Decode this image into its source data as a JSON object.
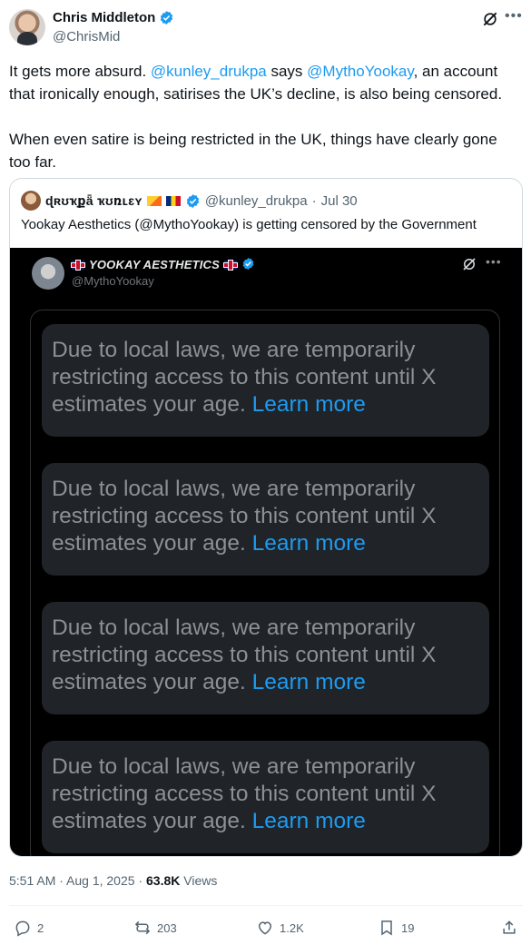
{
  "author": {
    "name": "Chris Middleton",
    "handle": "@ChrisMid",
    "avatar_icon": "avatar"
  },
  "tweet": {
    "para1": {
      "t1": "It gets more absurd. ",
      "mention1": "@kunley_drukpa",
      "t2": " says ",
      "mention2": "@MythoYookay",
      "t3": ", an account that ironically enough, satirises the UK’s decline, is also being censored."
    },
    "para2": "When even satire is being restricted in the UK, things have clearly gone too far."
  },
  "quoted": {
    "name": "ɖʀʊҡքǟ ҡʊռʟɛʏ",
    "handle": "@kunley_drukpa",
    "separator": " · ",
    "date": "Jul 30",
    "text": "Yookay Aesthetics (@MythoYookay) is getting censored by the Government",
    "flags": [
      "bhutan-flag",
      "romania-flag"
    ]
  },
  "media": {
    "name": "YOOKAY AESTHETICS",
    "handle": "@MythoYookay",
    "notices": [
      {
        "text": "Due to local laws, we are temporarily restricting access to this content until X estimates your age.",
        "link": "Learn more"
      },
      {
        "text": "Due to local laws, we are temporarily restricting access to this content until X estimates your age.",
        "link": "Learn more"
      },
      {
        "text": "Due to local laws, we are temporarily restricting access to this content until X estimates your age.",
        "link": "Learn more"
      },
      {
        "text": "Due to local laws, we are temporarily restricting access to this content until X estimates your age.",
        "link": "Learn more"
      }
    ]
  },
  "meta": {
    "time": "5:51 AM · Aug 1, 2025 · ",
    "views_count": "63.8K",
    "views_label": " Views"
  },
  "actions": {
    "replies": "2",
    "reposts": "203",
    "likes": "1.2K",
    "bookmarks": "19"
  },
  "colors": {
    "accent": "#1d9bf0",
    "text": "#0f1419",
    "muted": "#536471",
    "media_bg": "#000000",
    "notice_bg": "#202327"
  }
}
